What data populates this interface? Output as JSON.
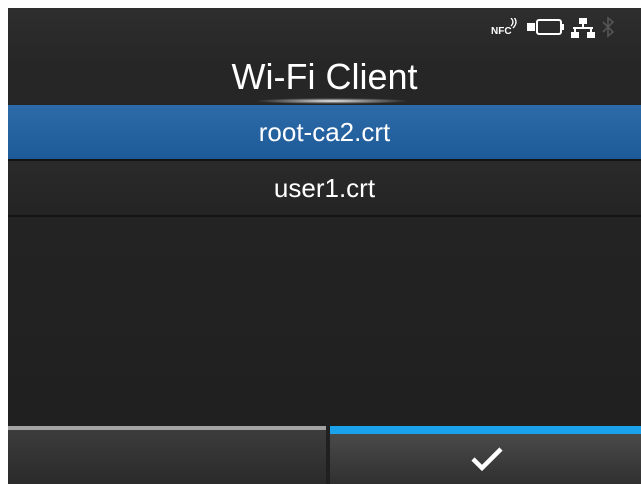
{
  "header": {
    "title": "Wi-Fi Client",
    "status_icons": [
      "nfc-icon",
      "battery-icon",
      "lan-icon",
      "bluetooth-icon"
    ]
  },
  "list": {
    "items": [
      {
        "label": "root-ca2.crt",
        "selected": true
      },
      {
        "label": "user1.crt",
        "selected": false
      }
    ]
  },
  "softkeys": {
    "left": {
      "label": ""
    },
    "right": {
      "icon": "check-icon"
    }
  },
  "colors": {
    "selection": "#1f5d9b",
    "softkey_accent": "#1aa3ec",
    "background": "#262626"
  }
}
